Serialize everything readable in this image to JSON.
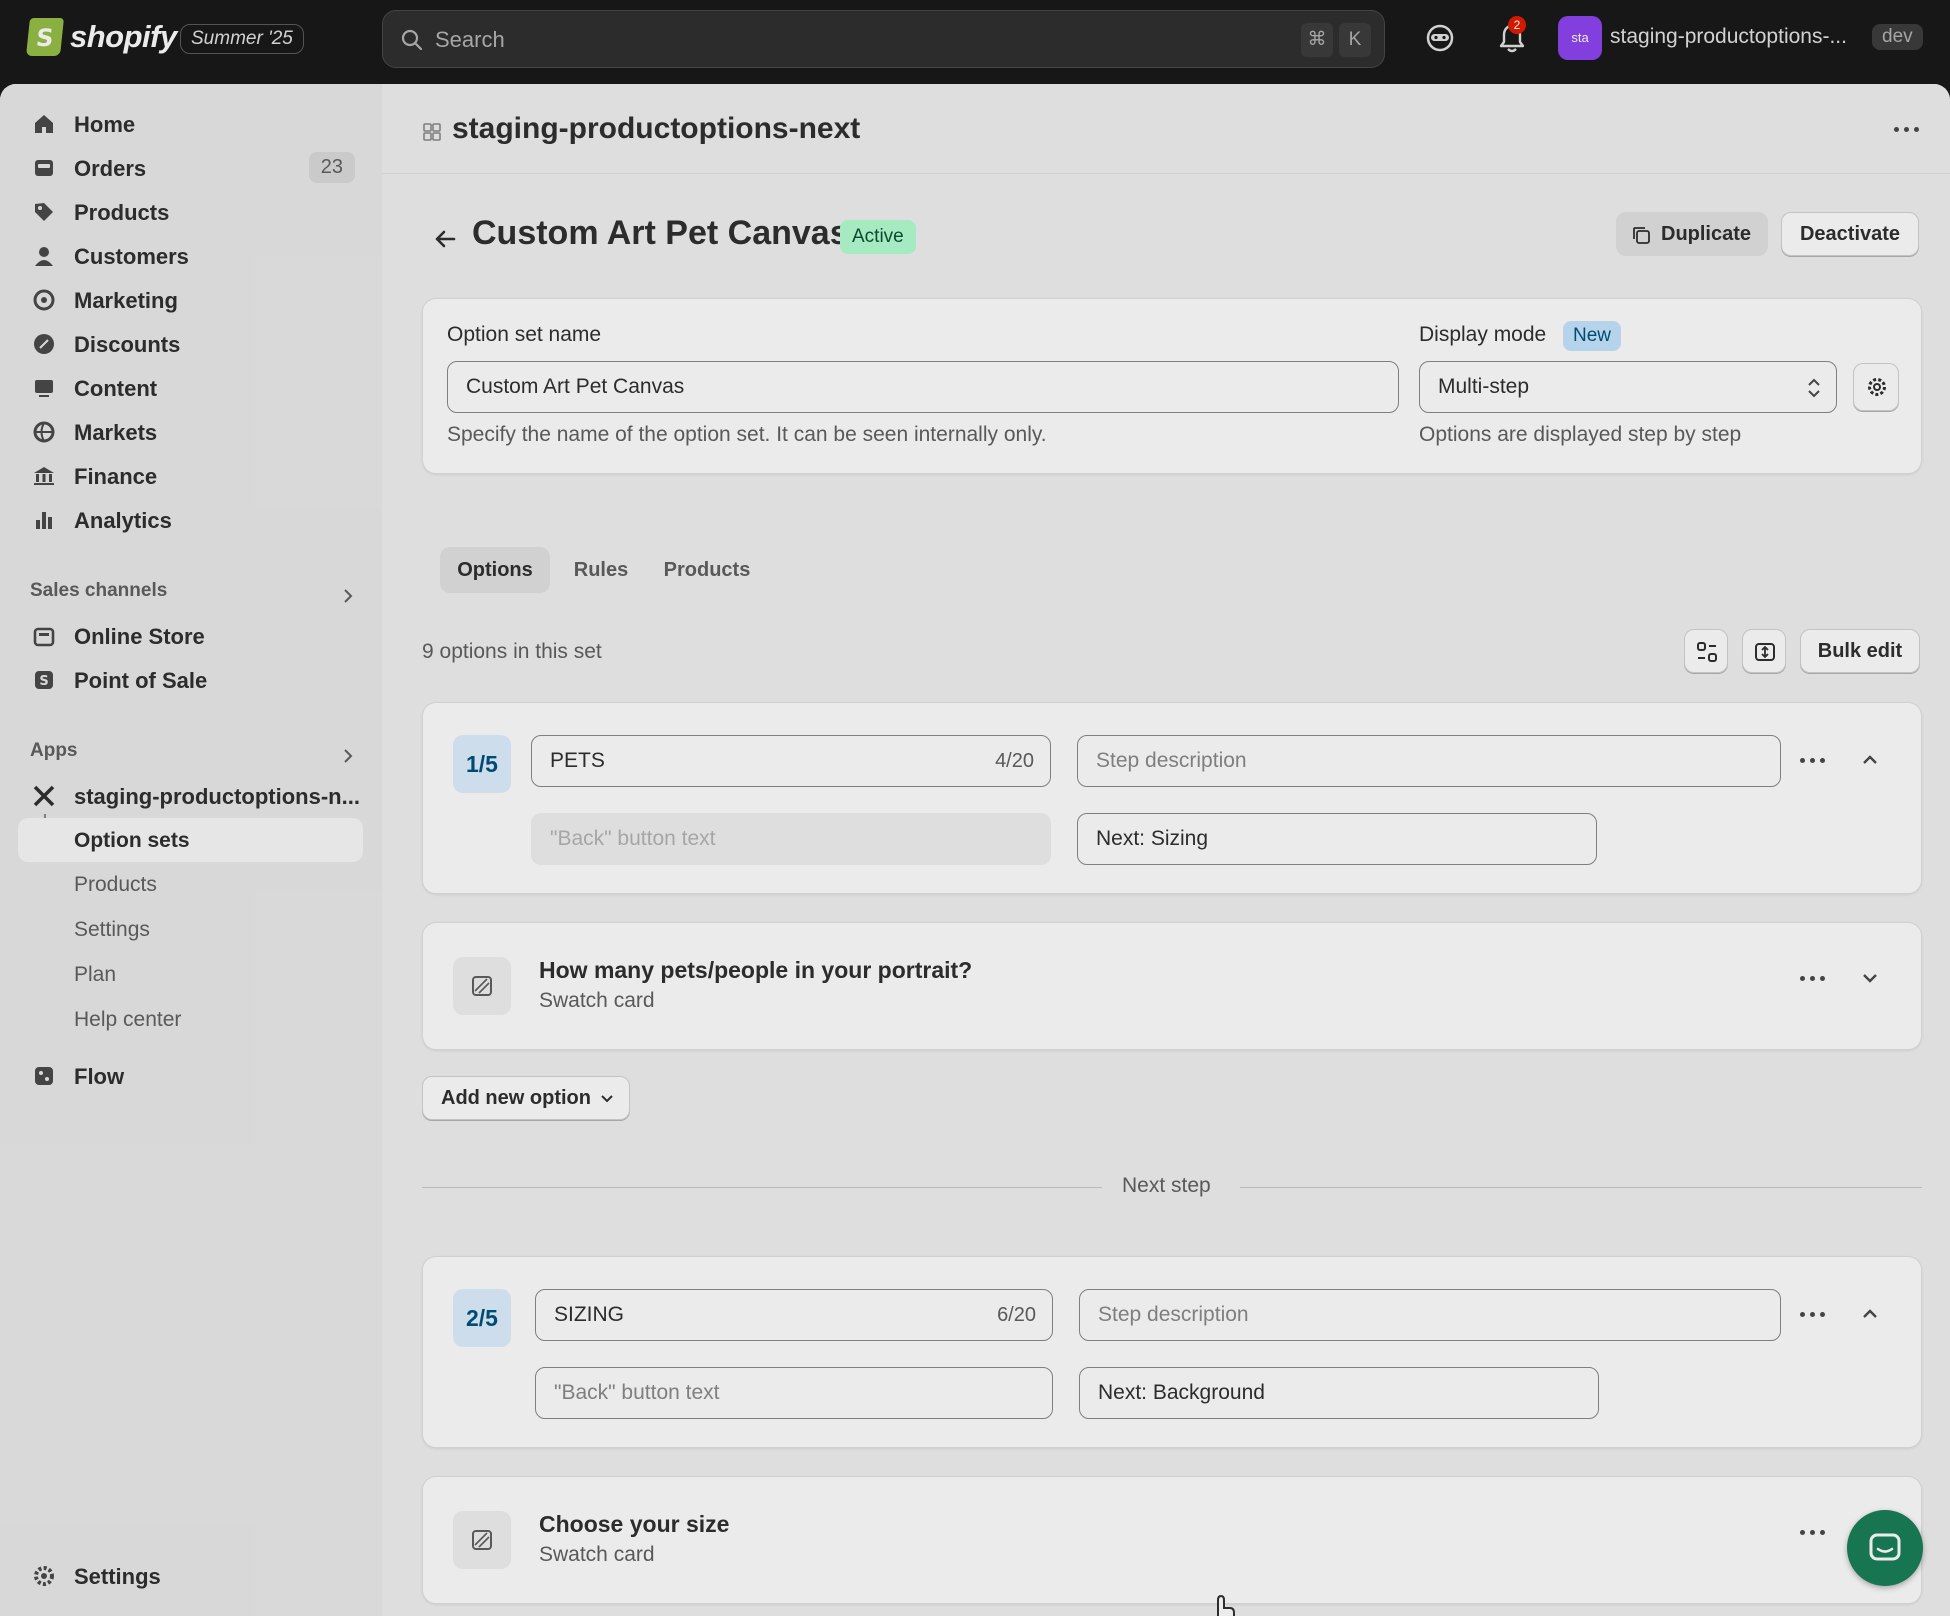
{
  "topbar": {
    "brand": "shopify",
    "edition": "Summer '25",
    "search_placeholder": "Search",
    "shortcut_keys": [
      "⌘",
      "K"
    ],
    "notification_count": "2",
    "store_avatar": "sta",
    "store_name": "staging-productoptions-...",
    "env_badge": "dev"
  },
  "sidebar": {
    "items": [
      {
        "label": "Home",
        "icon": "home-icon"
      },
      {
        "label": "Orders",
        "icon": "orders-icon",
        "count": "23"
      },
      {
        "label": "Products",
        "icon": "tag-icon"
      },
      {
        "label": "Customers",
        "icon": "person-icon"
      },
      {
        "label": "Marketing",
        "icon": "target-icon"
      },
      {
        "label": "Discounts",
        "icon": "discount-icon"
      },
      {
        "label": "Content",
        "icon": "content-icon"
      },
      {
        "label": "Markets",
        "icon": "globe-icon"
      },
      {
        "label": "Finance",
        "icon": "bank-icon"
      },
      {
        "label": "Analytics",
        "icon": "chart-icon"
      }
    ],
    "sales_channels_label": "Sales channels",
    "sales_channels": [
      {
        "label": "Online Store",
        "icon": "store-icon"
      },
      {
        "label": "Point of Sale",
        "icon": "pos-icon"
      }
    ],
    "apps_label": "Apps",
    "app_name": "staging-productoptions-n...",
    "app_subitems": [
      "Option sets",
      "Products",
      "Settings",
      "Plan",
      "Help center"
    ],
    "flow": "Flow",
    "settings": "Settings"
  },
  "app_header": {
    "title": "staging-productoptions-next"
  },
  "page": {
    "title": "Custom Art Pet Canvas",
    "status": "Active",
    "duplicate_label": "Duplicate",
    "deactivate_label": "Deactivate"
  },
  "settings_card": {
    "name_label": "Option set name",
    "name_value": "Custom Art Pet Canvas",
    "name_help": "Specify the name of the option set. It can be seen internally only.",
    "display_mode_label": "Display mode",
    "display_mode_badge": "New",
    "display_mode_value": "Multi-step",
    "display_mode_help": "Options are displayed step by step"
  },
  "tabs": [
    "Options",
    "Rules",
    "Products"
  ],
  "options_count": "9 options in this set",
  "bulk_edit_label": "Bulk edit",
  "steps": [
    {
      "badge": "1/5",
      "name": "PETS",
      "counter": "4/20",
      "description_placeholder": "Step description",
      "back_placeholder": "\"Back\" button text",
      "next_value": "Next: Sizing"
    },
    {
      "badge": "2/5",
      "name": "SIZING",
      "counter": "6/20",
      "description_placeholder": "Step description",
      "back_placeholder": "\"Back\" button text",
      "next_value": "Next: Background"
    }
  ],
  "options": [
    {
      "title": "How many pets/people in your portrait?",
      "type": "Swatch card"
    },
    {
      "title": "Choose your size",
      "type": "Swatch card"
    }
  ],
  "add_option_label": "Add new option",
  "next_step_label": "Next step"
}
